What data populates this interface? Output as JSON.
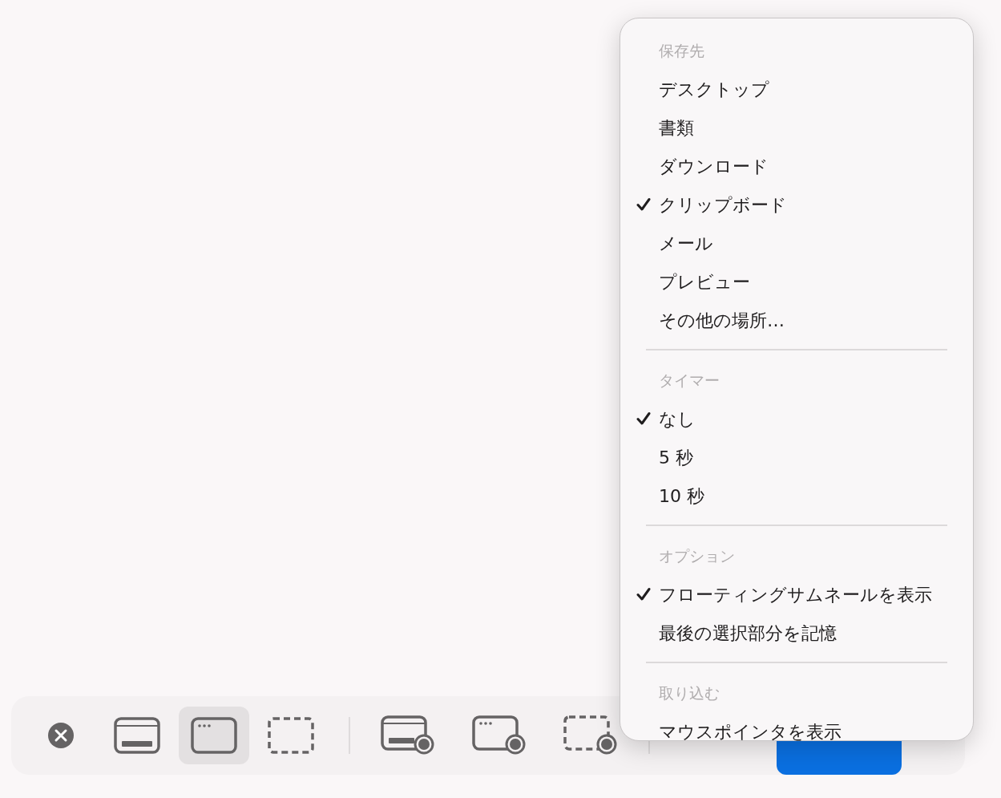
{
  "toolbar": {
    "tools": [
      {
        "kind": "close"
      },
      {
        "kind": "capture-screen",
        "selected": false
      },
      {
        "kind": "capture-window",
        "selected": true
      },
      {
        "kind": "capture-selection",
        "selected": false
      },
      {
        "kind": "divider"
      },
      {
        "kind": "record-screen",
        "selected": false
      },
      {
        "kind": "record-window",
        "selected": false
      },
      {
        "kind": "record-selection",
        "selected": false
      },
      {
        "kind": "divider"
      }
    ]
  },
  "menu": {
    "sections": [
      {
        "header": "保存先",
        "items": [
          {
            "label": "デスクトップ",
            "checked": false
          },
          {
            "label": "書類",
            "checked": false
          },
          {
            "label": "ダウンロード",
            "checked": false
          },
          {
            "label": "クリップボード",
            "checked": true
          },
          {
            "label": "メール",
            "checked": false
          },
          {
            "label": "プレビュー",
            "checked": false
          },
          {
            "label": "その他の場所…",
            "checked": false
          }
        ]
      },
      {
        "header": "タイマー",
        "items": [
          {
            "label": "なし",
            "checked": true
          },
          {
            "label": "5 秒",
            "checked": false
          },
          {
            "label": "10 秒",
            "checked": false
          }
        ]
      },
      {
        "header": "オプション",
        "items": [
          {
            "label": "フローティングサムネールを表示",
            "checked": true
          },
          {
            "label": "最後の選択部分を記憶",
            "checked": false
          }
        ]
      },
      {
        "header": "取り込む",
        "items": [
          {
            "label": "マウスポインタを表示",
            "checked": false
          }
        ]
      }
    ]
  }
}
